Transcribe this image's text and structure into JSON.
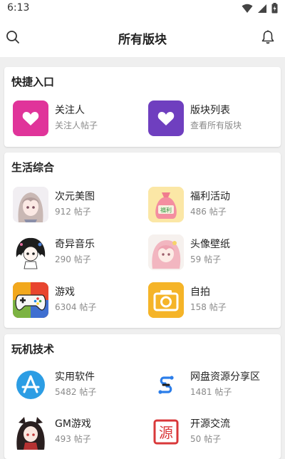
{
  "status": {
    "time": "6:13"
  },
  "header": {
    "title": "所有版块"
  },
  "quick": {
    "title": "快捷入口",
    "items": [
      {
        "name": "关注人",
        "sub": "关注人帖子",
        "icon": "heart-icon",
        "color": "#e0349a"
      },
      {
        "name": "版块列表",
        "sub": "查看所有版块",
        "icon": "heart-icon",
        "color": "#6f3fbf"
      }
    ]
  },
  "life": {
    "title": "生活综合",
    "items": [
      {
        "name": "次元美图",
        "sub": "912 帖子",
        "icon": "anime-girl-icon"
      },
      {
        "name": "福利活动",
        "sub": "486 帖子",
        "icon": "money-bag-icon"
      },
      {
        "name": "奇异音乐",
        "sub": "290 帖子",
        "icon": "anime-girl-icon"
      },
      {
        "name": "头像壁纸",
        "sub": "59 帖子",
        "icon": "anime-girl-icon"
      },
      {
        "name": "游戏",
        "sub": "6304 帖子",
        "icon": "gamepad-icon"
      },
      {
        "name": "自拍",
        "sub": "158 帖子",
        "icon": "camera-icon"
      }
    ]
  },
  "tech": {
    "title": "玩机技术",
    "items": [
      {
        "name": "实用软件",
        "sub": "5482 帖子",
        "icon": "app-store-icon"
      },
      {
        "name": "网盘资源分享区",
        "sub": "1481 帖子",
        "icon": "link-icon"
      },
      {
        "name": "GM游戏",
        "sub": "493 帖子",
        "icon": "anime-girl-icon"
      },
      {
        "name": "开源交流",
        "sub": "50 帖子",
        "icon": "source-stamp-icon"
      }
    ]
  },
  "stamp_text": "源",
  "bag_text": "福利"
}
